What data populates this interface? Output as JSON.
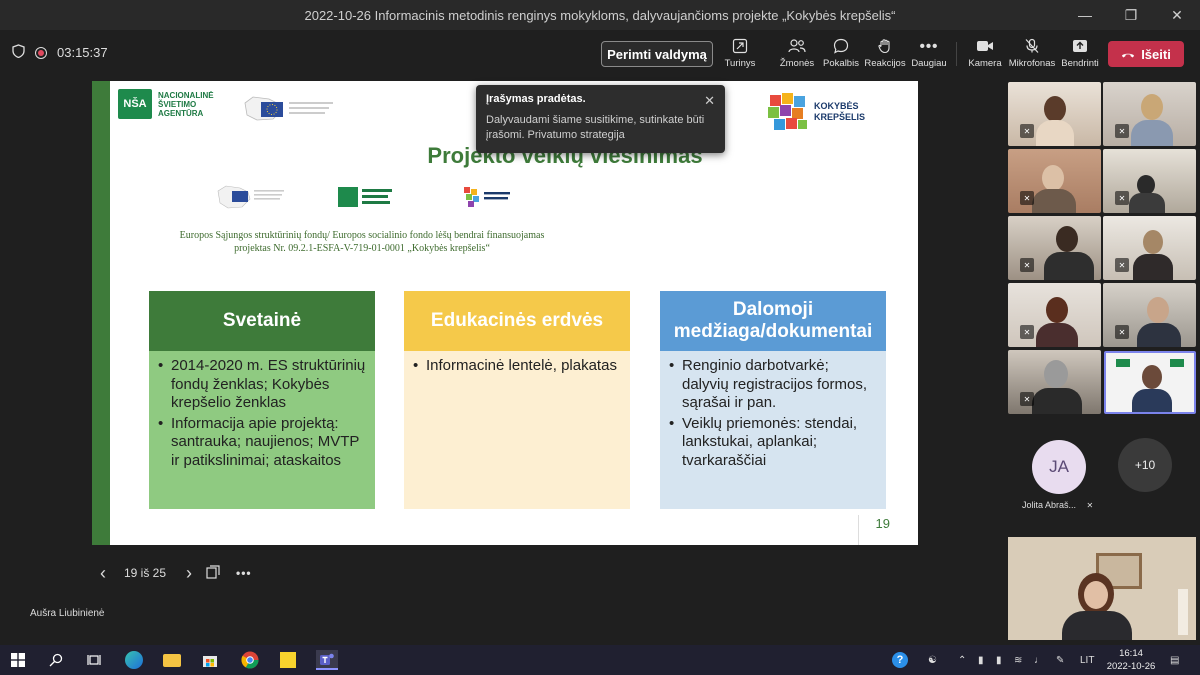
{
  "window": {
    "title": "2022-10-26 Informacinis metodinis renginys mokykloms, dalyvaujančioms projekte „Kokybės krepšelis“"
  },
  "meeting": {
    "timer": "03:15:37",
    "take_control": "Perimti valdymą",
    "leave": "Išeiti"
  },
  "toolbar": [
    {
      "label": "Turinys",
      "icon": "share-screen-icon"
    },
    {
      "label": "Žmonės",
      "icon": "people-icon"
    },
    {
      "label": "Pokalbis",
      "icon": "chat-icon"
    },
    {
      "label": "Reakcijos",
      "icon": "reactions-icon"
    },
    {
      "label": "Daugiau",
      "icon": "more-icon"
    },
    {
      "label": "Kamera",
      "icon": "camera-icon"
    },
    {
      "label": "Mikrofonas",
      "icon": "microphone-muted-icon"
    },
    {
      "label": "Bendrinti",
      "icon": "share-icon"
    }
  ],
  "toast": {
    "title": "Įrašymas pradėtas.",
    "body": "Dalyvaudami šiame susitikime, sutinkate būti įrašomi. Privatumo strategija"
  },
  "slide": {
    "title": "Projekto veiklų viešinimas",
    "nsa_logo": "NACIONALINĖ ŠVIETIMO AGENTŪRA",
    "nsa_mark": "NŠA",
    "kk_logo": "KOKYBĖS KREPŠELIS",
    "funding_line1": "Europos Sąjungos struktūrinių fondų/ Europos socialinio fondo lėšų bendrai finansuojamas",
    "funding_line2": "projektas Nr. 09.2.1-ESFA-V-719-01-0001 „Kokybės krepšelis“",
    "number": "19",
    "columns": [
      {
        "header": "Svetainė",
        "header_color": "#3e7b3a",
        "body_color": "#8fca81",
        "items": [
          "2014-2020 m. ES struktūrinių fondų ženklas; Kokybės krepšelio ženklas",
          "Informacija apie projektą: santrauka; naujienos; MVTP ir patikslinimai; ataskaitos"
        ]
      },
      {
        "header": "Edukacinės erdvės",
        "header_color": "#f5c94a",
        "body_color": "#fdefd2",
        "items": [
          "Informacinė lentelė, plakatas"
        ]
      },
      {
        "header": "Dalomoji medžiaga/dokumentai",
        "header_color": "#5b9bd5",
        "body_color": "#d6e4f0",
        "items": [
          "Renginio darbotvarkė; dalyvių registracijos formos, sąrašai ir pan.",
          "Veiklų priemonės: stendai, lankstukai, aplankai; tvarkaraščiai"
        ]
      }
    ]
  },
  "slide_nav": {
    "counter": "19 iš 25"
  },
  "presenter": "Aušra Liubinienė",
  "participants": {
    "avatar_initials": "JA",
    "avatar_name": "Jolita Abraš...",
    "more": "+10"
  },
  "taskbar": {
    "lang": "LIT",
    "time": "16:14",
    "date": "2022-10-26"
  }
}
